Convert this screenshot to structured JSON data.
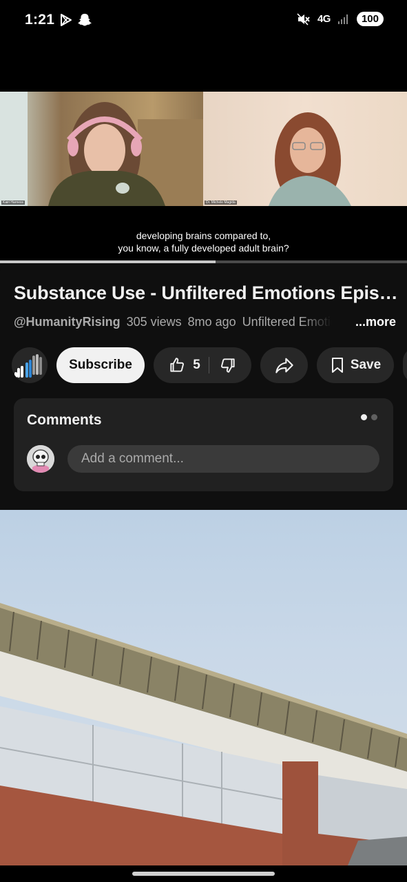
{
  "status_bar": {
    "time": "1:21",
    "network": "4G",
    "battery": "100",
    "left_icons": [
      "play-store-icon",
      "snapchat-icon"
    ],
    "right_icons": [
      "mute-icon",
      "signal-icon"
    ]
  },
  "player": {
    "participants": [
      "Kairi Harness",
      "Dr. Michele Magida"
    ],
    "captions": [
      "developing brains compared to,",
      "you know, a fully developed adult brain?"
    ],
    "progress": 0.53
  },
  "video": {
    "title": "Substance Use - Unfiltered Emotions Episode",
    "channel": "@HumanityRising",
    "views": "305 views",
    "age": "8mo ago",
    "playlist": "Unfiltered Emotions",
    "more_label": "...more"
  },
  "actions": {
    "subscribe_label": "Subscribe",
    "like_count": "5",
    "save_label": "Save"
  },
  "comments": {
    "title": "Comments",
    "input_placeholder": "Add a comment..."
  },
  "colors": {
    "background": "#0f0f0f",
    "card": "#212121",
    "pill": "#272727",
    "subscribe_bg": "#f1f1f1"
  }
}
